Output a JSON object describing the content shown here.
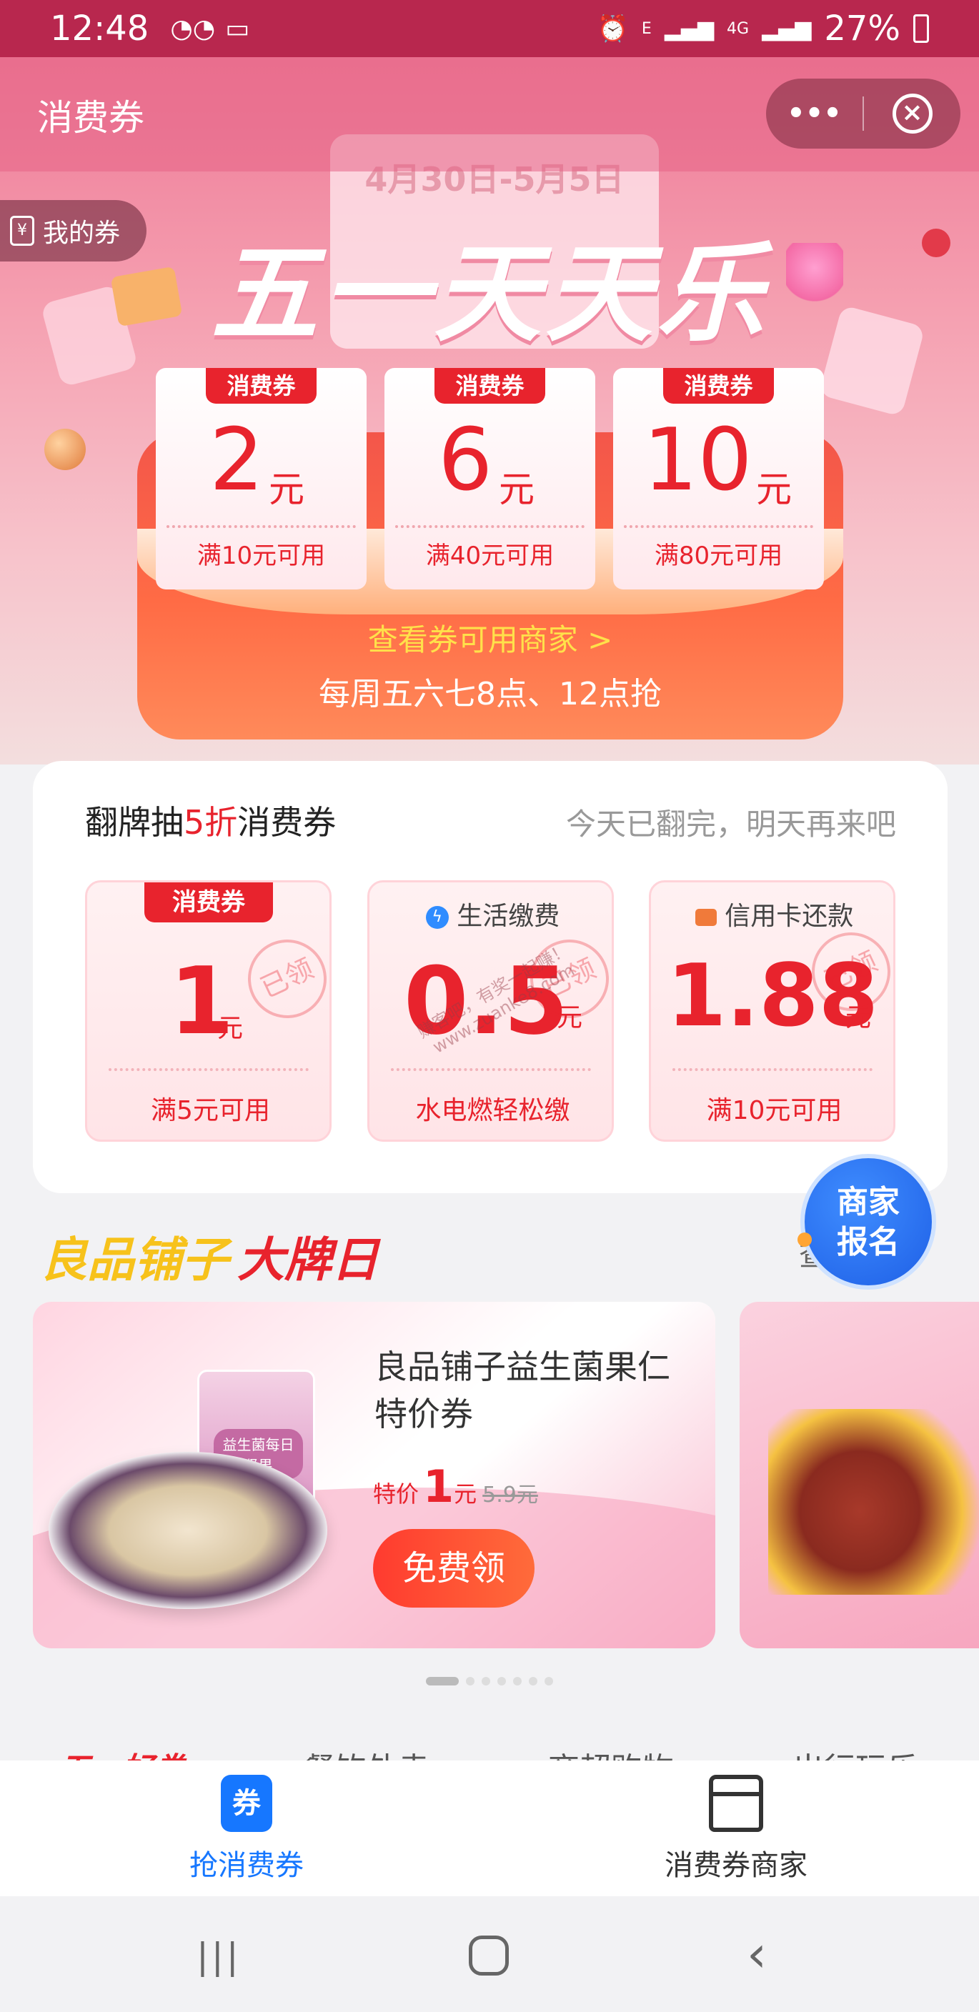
{
  "status_bar": {
    "time": "12:48",
    "battery": "27%",
    "network": "4G",
    "signal_e": "E"
  },
  "header": {
    "title": "消费券",
    "more_glyph": "•••",
    "close_glyph": "⊗"
  },
  "hero": {
    "my_coupons": "我的券",
    "date_range": "4月30日-5月5日",
    "event_title": "五一天天乐",
    "coupons": [
      {
        "tag": "消费券",
        "amount": "2",
        "unit": "元",
        "condition": "满10元可用"
      },
      {
        "tag": "消费券",
        "amount": "6",
        "unit": "元",
        "condition": "满40元可用"
      },
      {
        "tag": "消费券",
        "amount": "10",
        "unit": "元",
        "condition": "满80元可用"
      }
    ],
    "merchants_link": "查看券可用商家 >",
    "schedule": "每周五六七8点、12点抢"
  },
  "flip": {
    "title_prefix": "翻牌抽",
    "title_highlight": "5折",
    "title_suffix": "消费券",
    "status": "今天已翻完，明天再来吧",
    "cards": [
      {
        "tag": "消费券",
        "amount": "1",
        "unit": "元",
        "stamp": "已领",
        "condition": "满5元可用"
      },
      {
        "tag": "生活缴费",
        "amount": "0.5",
        "unit": "元",
        "stamp": "已领",
        "condition": "水电燃轻松缴"
      },
      {
        "tag": "信用卡还款",
        "amount": "1.88",
        "unit": "元",
        "stamp": "已领",
        "condition": "满10元可用"
      }
    ],
    "watermark": "赚客吧，有奖一起赚！ www.zuanke8.com"
  },
  "brand_day": {
    "brand": "良品铺子",
    "suffix": "大牌日",
    "more": "查",
    "float_button": "商家报名",
    "product": {
      "name": "良品铺子益生菌果仁特价券",
      "price_label": "特价",
      "price": "1",
      "price_unit": "元",
      "original_price": "5.9元",
      "button": "免费领",
      "package_text": "益生菌每日坚果"
    }
  },
  "category_strip": [
    "五一好券",
    "餐饮外卖",
    "商超购物",
    "出行玩乐"
  ],
  "tabbar": {
    "tabs": [
      {
        "label": "抢消费券",
        "icon_text": "券",
        "active": true
      },
      {
        "label": "消费券商家",
        "active": false
      }
    ]
  },
  "colors": {
    "accent_red": "#e8232d",
    "tab_blue": "#1677ff",
    "status_bar": "#b8274e"
  }
}
